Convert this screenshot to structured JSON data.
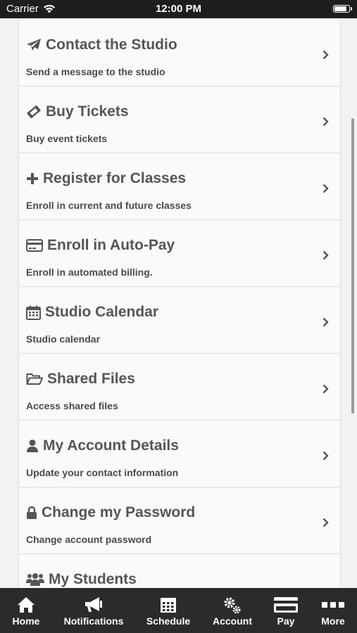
{
  "status_bar": {
    "carrier": "Carrier",
    "time": "12:00 PM",
    "battery_level": 0.9
  },
  "menu": {
    "items": [
      {
        "title": "Contact the Studio",
        "subtitle": "Send a message to the studio",
        "icon": "paper-plane-icon"
      },
      {
        "title": "Buy Tickets",
        "subtitle": "Buy event tickets",
        "icon": "ticket-icon"
      },
      {
        "title": "Register for Classes",
        "subtitle": "Enroll in current and future classes",
        "icon": "plus-icon"
      },
      {
        "title": "Enroll in Auto-Pay",
        "subtitle": "Enroll in automated billing.",
        "icon": "credit-card-icon"
      },
      {
        "title": "Studio Calendar",
        "subtitle": "Studio calendar",
        "icon": "calendar-icon"
      },
      {
        "title": "Shared Files",
        "subtitle": "Access shared files",
        "icon": "folder-open-icon"
      },
      {
        "title": "My Account Details",
        "subtitle": "Update your contact information",
        "icon": "user-icon"
      },
      {
        "title": "Change my Password",
        "subtitle": "Change account password",
        "icon": "lock-icon"
      },
      {
        "title": "My Students",
        "subtitle": "",
        "icon": "users-icon"
      }
    ]
  },
  "tab_bar": {
    "tabs": [
      {
        "label": "Home",
        "icon": "home-icon"
      },
      {
        "label": "Notifications",
        "icon": "megaphone-icon"
      },
      {
        "label": "Schedule",
        "icon": "calendar-grid-icon"
      },
      {
        "label": "Account",
        "icon": "gears-icon"
      },
      {
        "label": "Pay",
        "icon": "credit-card-icon"
      },
      {
        "label": "More",
        "icon": "more-icon"
      }
    ]
  }
}
